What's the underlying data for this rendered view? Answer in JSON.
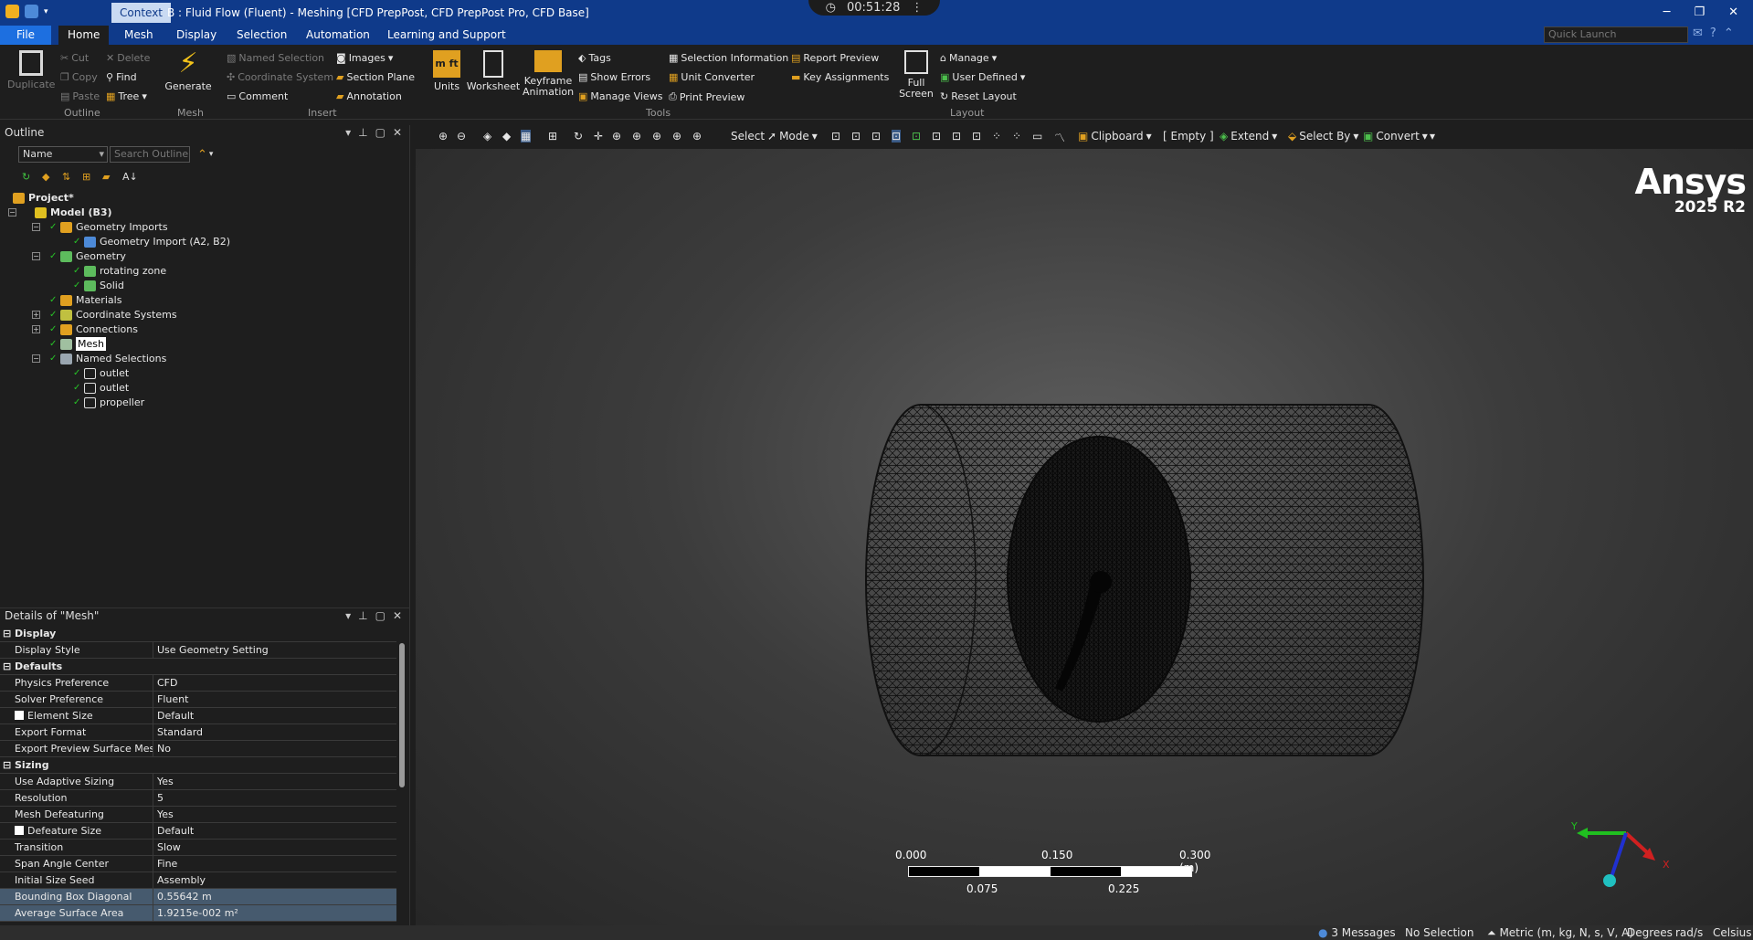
{
  "titlebar": {
    "context_tab": "Context",
    "window_title": "B : Fluid Flow (Fluent) - Meshing [CFD PrepPost, CFD PrepPost Pro, CFD Base]",
    "timer": "00:51:28"
  },
  "ribbon_tabs": [
    "File",
    "Home",
    "Mesh",
    "Display",
    "Selection",
    "Automation",
    "Learning and Support"
  ],
  "quick_launch_placeholder": "Quick Launch",
  "ribbon": {
    "outline_group": {
      "duplicate": "Duplicate",
      "cut": "Cut",
      "copy": "Copy",
      "paste": "Paste",
      "delete": "Delete",
      "find": "Find",
      "tree": "Tree",
      "label": "Outline"
    },
    "mesh_group": {
      "generate": "Generate",
      "label": "Mesh"
    },
    "insert_group": {
      "named_selection": "Named Selection",
      "coordinate_system": "Coordinate System",
      "comment": "Comment",
      "images": "Images",
      "section_plane": "Section Plane",
      "annotation": "Annotation",
      "label": "Insert"
    },
    "tools_group": {
      "units": "Units",
      "worksheet": "Worksheet",
      "keyframe": "Keyframe",
      "animation": "Animation",
      "tags": "Tags",
      "show_errors": "Show Errors",
      "manage_views": "Manage Views",
      "selection_information": "Selection Information",
      "unit_converter": "Unit Converter",
      "print_preview": "Print Preview",
      "report_preview": "Report Preview",
      "key_assignments": "Key Assignments",
      "label": "Tools"
    },
    "layout_group": {
      "full": "Full",
      "screen": "Screen",
      "manage": "Manage",
      "user_defined": "User Defined",
      "reset_layout": "Reset Layout",
      "label": "Layout"
    }
  },
  "outline": {
    "title": "Outline",
    "filter_field": "Name",
    "search_placeholder": "Search Outline",
    "tree": [
      {
        "label": "Project*"
      },
      {
        "label": "Model (B3)"
      },
      {
        "label": "Geometry Imports"
      },
      {
        "label": "Geometry Import (A2, B2)"
      },
      {
        "label": "Geometry"
      },
      {
        "label": "rotating zone"
      },
      {
        "label": "Solid"
      },
      {
        "label": "Materials"
      },
      {
        "label": "Coordinate Systems"
      },
      {
        "label": "Connections"
      },
      {
        "label": "Mesh"
      },
      {
        "label": "Named Selections"
      },
      {
        "label": "outlet"
      },
      {
        "label": "outlet"
      },
      {
        "label": "propeller"
      }
    ]
  },
  "details": {
    "title": "Details of \"Mesh\"",
    "rows": [
      {
        "key": "Display",
        "value": ""
      },
      {
        "key": "Display Style",
        "value": "Use Geometry Setting"
      },
      {
        "key": "Defaults",
        "value": ""
      },
      {
        "key": "Physics Preference",
        "value": "CFD"
      },
      {
        "key": "Solver Preference",
        "value": "Fluent"
      },
      {
        "key": "Element Size",
        "value": "Default"
      },
      {
        "key": "Export Format",
        "value": "Standard"
      },
      {
        "key": "Export Preview Surface Mesh",
        "value": "No"
      },
      {
        "key": "Sizing",
        "value": ""
      },
      {
        "key": "Use Adaptive Sizing",
        "value": "Yes"
      },
      {
        "key": "Resolution",
        "value": "5"
      },
      {
        "key": "Mesh Defeaturing",
        "value": "Yes"
      },
      {
        "key": "Defeature Size",
        "value": "Default"
      },
      {
        "key": "Transition",
        "value": "Slow"
      },
      {
        "key": "Span Angle Center",
        "value": "Fine"
      },
      {
        "key": "Initial Size Seed",
        "value": "Assembly"
      },
      {
        "key": "Bounding Box Diagonal",
        "value": "0.55642 m"
      },
      {
        "key": "Average Surface Area",
        "value": "1.9215e-002 m²"
      }
    ]
  },
  "viewport_toolbar": {
    "select": "Select",
    "mode": "Mode",
    "clipboard": "Clipboard",
    "empty": "[ Empty ]",
    "extend": "Extend",
    "select_by": "Select By",
    "convert": "Convert"
  },
  "viewport": {
    "logo": "Ansys",
    "version": "2025 R2",
    "scale_top": [
      "0.000",
      "0.150",
      "0.300 (m)"
    ],
    "scale_bottom": [
      "0.075",
      "0.225"
    ],
    "triad": {
      "y": "Y",
      "x": "X"
    }
  },
  "status": {
    "messages": "3 Messages",
    "selection": "No Selection",
    "units": "Metric (m, kg, N, s, V, A)",
    "angle": "Degrees",
    "rate": "rad/s",
    "temp": "Celsius"
  }
}
